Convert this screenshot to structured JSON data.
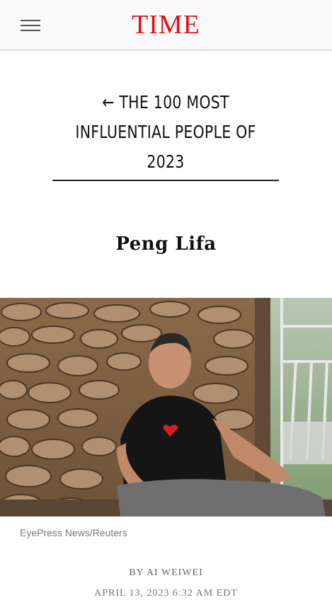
{
  "header": {
    "logo": "TIME",
    "menu_icon": "hamburger-menu-icon",
    "brand_color": "#e10f1a"
  },
  "article": {
    "back_arrow": "←",
    "section_link": "THE 100 MOST INFLUENTIAL PEOPLE OF 2023",
    "title": "Peng Lifa",
    "photo_credit": "EyePress News/Reuters",
    "byline_prefix": "BY",
    "author": "AI WEIWEI",
    "date": "APRIL 13, 2023 6:32 AM EDT"
  }
}
